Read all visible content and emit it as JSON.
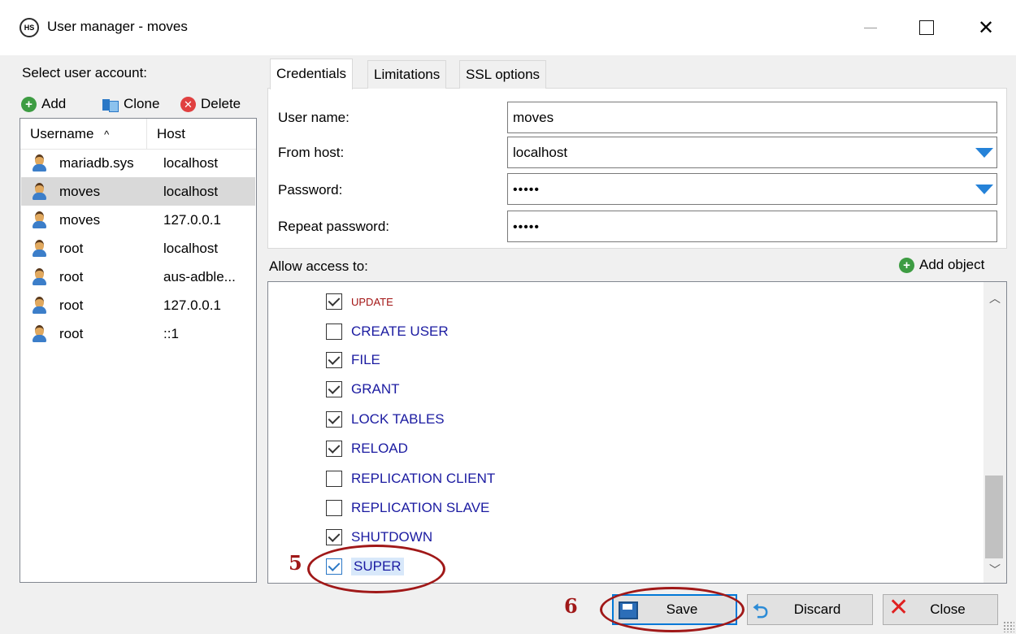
{
  "window": {
    "icon_text": "HS",
    "title": "User manager - moves",
    "close_symbol": "✕"
  },
  "left": {
    "select_label": "Select user account:",
    "toolbar": {
      "add": "Add",
      "clone": "Clone",
      "delete": "Delete"
    },
    "columns": {
      "username": "Username",
      "sort_indicator": "^",
      "host": "Host"
    },
    "users": [
      {
        "username": "mariadb.sys",
        "host": "localhost"
      },
      {
        "username": "moves",
        "host": "localhost"
      },
      {
        "username": "moves",
        "host": "127.0.0.1"
      },
      {
        "username": "root",
        "host": "localhost"
      },
      {
        "username": "root",
        "host": "aus-adble..."
      },
      {
        "username": "root",
        "host": "127.0.0.1"
      },
      {
        "username": "root",
        "host": "::1"
      }
    ]
  },
  "tabs": {
    "credentials": "Credentials",
    "limitations": "Limitations",
    "ssl": "SSL options"
  },
  "credentials": {
    "user_name_label": "User name:",
    "user_name_value": "moves",
    "from_host_label": "From host:",
    "from_host_value": "localhost",
    "password_label": "Password:",
    "password_value": "•••••",
    "repeat_password_label": "Repeat password:",
    "repeat_password_value": "•••••"
  },
  "access": {
    "label": "Allow access to:",
    "add_object": "Add object",
    "privileges": [
      {
        "name": "UPDATE",
        "checked": true
      },
      {
        "name": "CREATE USER",
        "checked": false
      },
      {
        "name": "FILE",
        "checked": true
      },
      {
        "name": "GRANT",
        "checked": true
      },
      {
        "name": "LOCK TABLES",
        "checked": true
      },
      {
        "name": "RELOAD",
        "checked": true
      },
      {
        "name": "REPLICATION CLIENT",
        "checked": false
      },
      {
        "name": "REPLICATION SLAVE",
        "checked": false
      },
      {
        "name": "SHUTDOWN",
        "checked": true
      },
      {
        "name": "SUPER",
        "checked": true
      }
    ]
  },
  "annotations": {
    "step5": "5",
    "step6": "6"
  },
  "buttons": {
    "save": "Save",
    "discard": "Discard",
    "close": "Close"
  },
  "colors": {
    "annotation": "#a01818",
    "accent": "#0078d7",
    "privilege_text": "#1b1ba1",
    "privilege_update": "#a31515"
  }
}
